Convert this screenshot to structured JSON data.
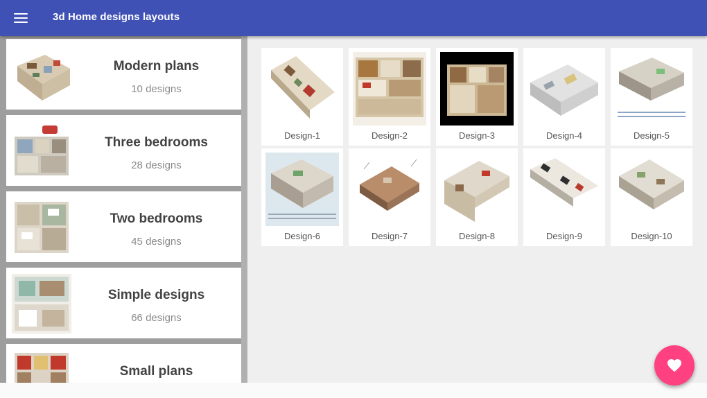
{
  "app": {
    "title": "3d Home designs layouts",
    "menu_icon": "menu-icon",
    "fab_icon": "heart-icon",
    "colors": {
      "primary": "#3f51b5",
      "accent": "#ff4081"
    }
  },
  "categories": [
    {
      "title": "Modern plans",
      "count": "10 designs"
    },
    {
      "title": "Three bedrooms",
      "count": "28 designs"
    },
    {
      "title": "Two bedrooms",
      "count": "45 designs"
    },
    {
      "title": "Simple designs",
      "count": "66 designs"
    },
    {
      "title": "Small plans",
      "count": ""
    }
  ],
  "designs": [
    {
      "label": "Design-1"
    },
    {
      "label": "Design-2"
    },
    {
      "label": "Design-3"
    },
    {
      "label": "Design-4"
    },
    {
      "label": "Design-5"
    },
    {
      "label": "Design-6"
    },
    {
      "label": "Design-7"
    },
    {
      "label": "Design-8"
    },
    {
      "label": "Design-9"
    },
    {
      "label": "Design-10"
    }
  ]
}
